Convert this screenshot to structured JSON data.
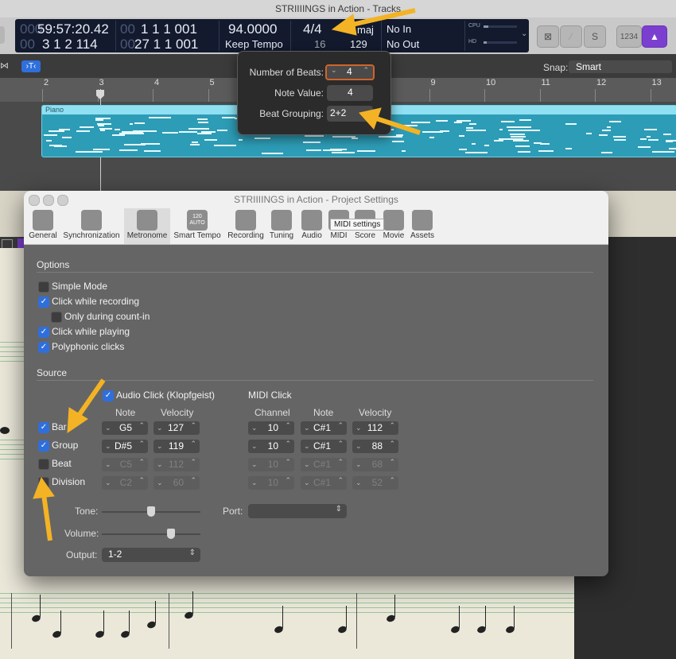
{
  "app": {
    "title": "STRIIIINGS in Action - Tracks"
  },
  "lcd": {
    "time_main": "59:57:20.42",
    "time_prefix_dim": "000",
    "bars_dim": "00",
    "bars_pos": "1 1 1 001",
    "beats_pos": "3 1 2 114",
    "beats_pos2": "27 1 1 001",
    "beats_dim": "00",
    "tempo": "94.0000",
    "tempo_mode": "Keep Tempo",
    "sig": "4/4",
    "sig_denom": "16",
    "key": "maj",
    "bpm_right": "129",
    "in_label": "No In",
    "out_label": "No Out",
    "cpu": "CPU",
    "hd": "HD"
  },
  "toolbar": {
    "count_in": "1234"
  },
  "ruler": {
    "snap_label": "Snap:",
    "snap_value": "Smart",
    "bars": [
      "2",
      "3",
      "4",
      "5",
      "6",
      "7",
      "8",
      "9",
      "10",
      "11",
      "12",
      "13"
    ]
  },
  "region": {
    "name": "Piano"
  },
  "popover": {
    "beats_label": "Number of Beats:",
    "beats_value": "4",
    "note_label": "Note Value:",
    "note_value": "4",
    "group_label": "Beat Grouping:",
    "group_value": "2+2"
  },
  "settings": {
    "title": "STRIIIINGS in Action - Project Settings",
    "tabs": [
      {
        "label": "General",
        "icon": "general-icon"
      },
      {
        "label": "Synchronization",
        "icon": "sync-icon"
      },
      {
        "label": "Metronome",
        "icon": "metronome-icon"
      },
      {
        "label": "Smart Tempo",
        "icon": "smart-tempo-icon",
        "icon_text": "120\nAUTO"
      },
      {
        "label": "Recording",
        "icon": "record-icon"
      },
      {
        "label": "Tuning",
        "icon": "tuning-fork-icon"
      },
      {
        "label": "Audio",
        "icon": "audio-wave-icon"
      },
      {
        "label": "MIDI",
        "icon": "midi-icon"
      },
      {
        "label": "Score",
        "icon": "score-icon"
      },
      {
        "label": "Movie",
        "icon": "movie-icon"
      },
      {
        "label": "Assets",
        "icon": "assets-icon"
      }
    ],
    "tooltip": "MIDI settings",
    "options_title": "Options",
    "options": [
      {
        "label": "Simple Mode",
        "checked": false
      },
      {
        "label": "Click while recording",
        "checked": true
      },
      {
        "label": "Only during count-in",
        "checked": false
      },
      {
        "label": "Click while playing",
        "checked": true
      },
      {
        "label": "Polyphonic clicks",
        "checked": true
      }
    ],
    "source_title": "Source",
    "audio_click_label": "Audio Click (Klopfgeist)",
    "midi_click_label": "MIDI Click",
    "col_note": "Note",
    "col_velocity": "Velocity",
    "col_channel": "Channel",
    "col_note2": "Note",
    "col_velocity2": "Velocity",
    "rows": [
      {
        "label": "Bar",
        "checked": true,
        "note": "G5",
        "vel": "127",
        "ch": "10",
        "mnote": "C#1",
        "mvel": "112"
      },
      {
        "label": "Group",
        "checked": true,
        "note": "D#5",
        "vel": "119",
        "ch": "10",
        "mnote": "C#1",
        "mvel": "88"
      },
      {
        "label": "Beat",
        "checked": false,
        "note": "C5",
        "vel": "112",
        "ch": "10",
        "mnote": "C#1",
        "mvel": "68"
      },
      {
        "label": "Division",
        "checked": false,
        "note": "C2",
        "vel": "60",
        "ch": "10",
        "mnote": "C#1",
        "mvel": "52"
      }
    ],
    "tone_label": "Tone:",
    "tone_level": 0.5,
    "volume_label": "Volume:",
    "volume_level": 0.7,
    "port_label": "Port:",
    "output_label": "Output:",
    "output_value": "1-2"
  },
  "colors": {
    "accent": "#2f6fdc",
    "arrow": "#f4b324",
    "region": "#2d9cb6",
    "metronome_purple": "#7b3fd0"
  }
}
